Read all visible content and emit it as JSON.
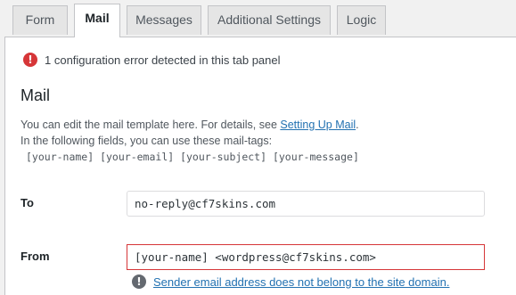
{
  "tabs": [
    {
      "label": "Form"
    },
    {
      "label": "Mail",
      "active": true
    },
    {
      "label": "Messages"
    },
    {
      "label": "Additional Settings"
    },
    {
      "label": "Logic"
    }
  ],
  "panel": {
    "config_error_icon": "!",
    "config_error_text": "1 configuration error detected in this tab panel",
    "title": "Mail",
    "desc_line1_prefix": "You can edit the mail template here. For details, see ",
    "desc_link": "Setting Up Mail",
    "desc_line1_suffix": ".",
    "desc_line2": "In the following fields, you can use these mail-tags:",
    "mail_tags": "[your-name] [your-email] [your-subject] [your-message]"
  },
  "fields": {
    "to": {
      "label": "To",
      "value": "no-reply@cf7skins.com"
    },
    "from": {
      "label": "From",
      "value": "[your-name] <wordpress@cf7skins.com>",
      "warning_icon": "!",
      "warning_text": "Sender email address does not belong to the site domain."
    }
  },
  "colors": {
    "error": "#d63638",
    "link": "#2271b1",
    "background": "#f1f1f1"
  }
}
